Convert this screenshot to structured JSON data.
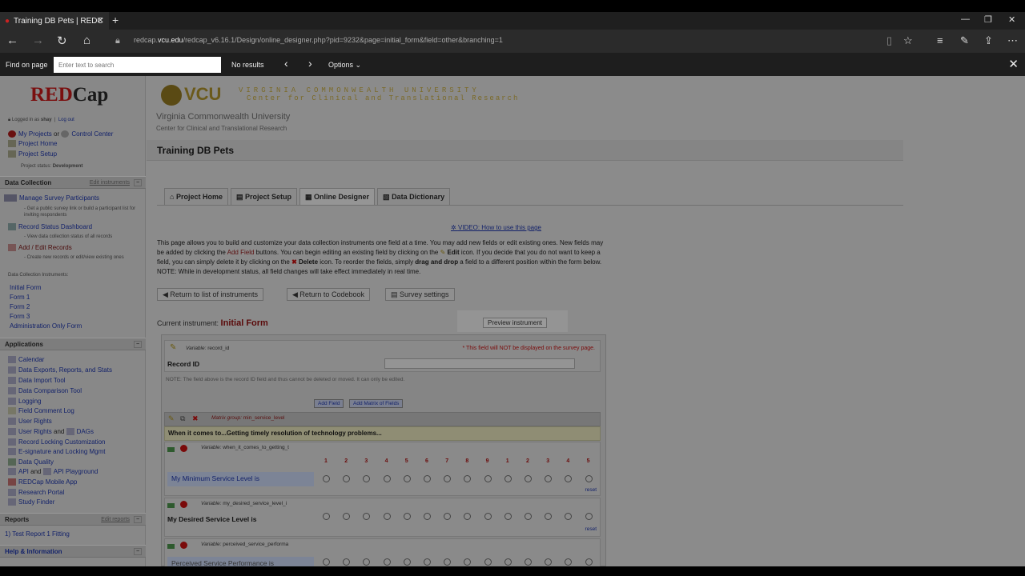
{
  "browser": {
    "tab_title": "Training DB Pets | REDC",
    "url_host": "redcap.vcu.edu",
    "url_prefix": "redcap.",
    "url_domain": "vcu.edu",
    "url_path": "/redcap_v6.16.1/Design/online_designer.php?pid=9232&page=initial_form&field=other&branching=1",
    "find": {
      "label": "Find on page",
      "placeholder": "Enter text to search",
      "results": "No results",
      "options": "Options"
    }
  },
  "sidebar": {
    "logo_red": "RED",
    "logo_cap": "Cap",
    "logged_in": "Logged in as",
    "user": "shay",
    "logout": "Log out",
    "my_projects": "My Projects",
    "or": "or",
    "control_center": "Control Center",
    "project_home": "Project Home",
    "project_setup": "Project Setup",
    "status_label": "Project status:",
    "status_value": "Development",
    "data_collection": "Data Collection",
    "edit_instruments": "Edit instruments",
    "manage_survey": "Manage Survey Participants",
    "manage_survey_desc": "- Get a public survey link or build a participant list for inviting respondents",
    "record_status": "Record Status Dashboard",
    "record_status_desc": "- View data collection status of all records",
    "add_edit": "Add / Edit Records",
    "add_edit_desc": "- Create new records or edit/view existing ones",
    "instruments_label": "Data Collection Instruments:",
    "instruments": [
      "Initial Form",
      "Form 1",
      "Form 2",
      "Form 3",
      "Administration Only Form"
    ],
    "applications": "Applications",
    "apps": [
      "Calendar",
      "Data Exports, Reports, and Stats",
      "Data Import Tool",
      "Data Comparison Tool",
      "Logging",
      "Field Comment Log",
      "User Rights",
      "DAGs",
      "Record Locking Customization",
      "E-signature and Locking Mgmt",
      "Data Quality",
      "API",
      "API Playground",
      "REDCap Mobile App",
      "Research Portal",
      "Study Finder"
    ],
    "and": "and",
    "reports": "Reports",
    "edit_reports": "Edit reports",
    "report_1": "Test Report 1 Fitting",
    "help": "Help & Information"
  },
  "header": {
    "vcu": "VCU",
    "vcu_line1": "VIRGINIA COMMONWEALTH UNIVERSITY",
    "vcu_line2": "Center for Clinical and Translational Research",
    "university": "Virginia Commonwealth University",
    "center": "Center for Clinical and Translational Research",
    "project_title": "Training DB Pets"
  },
  "tabs": [
    "Project Home",
    "Project Setup",
    "Online Designer",
    "Data Dictionary"
  ],
  "main": {
    "video": "VIDEO: How to use this page",
    "intro_1": "This page allows you to build and customize your data collection instruments one field at a time. You may add new fields or edit existing ones. New fields may be added by clicking the ",
    "add_field_link": "Add Field",
    "intro_2": " buttons. You can begin editing an existing field by clicking on the ",
    "edit_word": "Edit",
    "intro_3": " icon. If you decide that you do not want to keep a field, you can simply delete it by clicking on the ",
    "delete_word": "Delete",
    "intro_4": " icon. To reorder the fields, simply ",
    "dnd_word": "drag and drop",
    "intro_5": " a field to a different position within the form below. NOTE: While in development status, all field changes will take effect immediately in real time.",
    "btn_return_list": "Return to list of instruments",
    "btn_return_codebook": "Return to Codebook",
    "btn_survey_settings": "Survey settings",
    "current_label": "Current instrument:",
    "current_name": "Initial Form",
    "preview": "Preview instrument"
  },
  "form": {
    "variable_label": "Variable:",
    "record_var": "record_id",
    "warning": "* This field will NOT be displayed on the survey page.",
    "record_label": "Record ID",
    "note": "NOTE: The field above is the record ID field and thus cannot be deleted or moved. It can only be edited.",
    "add_field": "Add Field",
    "add_matrix": "Add Matrix of Fields",
    "matrix_group_label": "Matrix group:",
    "matrix_group": "min_service_level",
    "matrix_header": "When it comes to...Getting timely resolution of technology problems...",
    "scale": [
      "1",
      "2",
      "3",
      "4",
      "5",
      "6",
      "7",
      "8",
      "9",
      "1",
      "2",
      "3",
      "4",
      "5"
    ],
    "reset": "reset",
    "rows": [
      {
        "var": "when_it_comes_to_getting_t",
        "label": "My Minimum Service Level is"
      },
      {
        "var": "my_desired_service_level_i",
        "label": "My Desired Service Level is"
      },
      {
        "var": "perceived_service_performa",
        "label": "Perceived Service Performance is"
      }
    ]
  }
}
